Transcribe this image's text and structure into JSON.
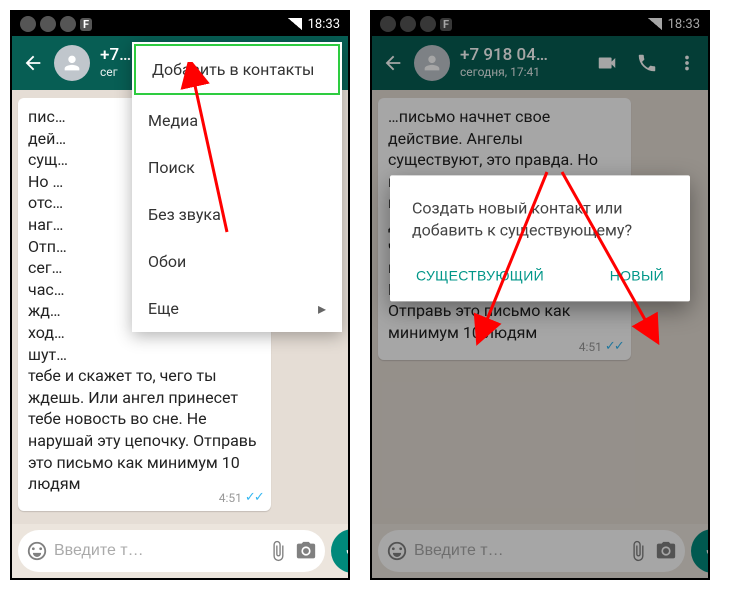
{
  "statusbar": {
    "time": "18:33",
    "f_icon": "F"
  },
  "left": {
    "header": {
      "contact_name": "+7…",
      "subline": "сег"
    },
    "menu": {
      "add_to_contacts": "Добавить в контакты",
      "media": "Медиа",
      "search": "Поиск",
      "mute": "Без звука",
      "wallpaper": "Обои",
      "more": "Еще"
    },
    "bubble": {
      "text": "пис…\nдей…\nсущ…\nНо …\nотс…\nнаг…\nОтп…\nсег…\nчас…\nжд…\nход…\nшут…\nтебе и скажет то, чего ты ждешь. Или ангел принесет тебе новость во сне. Не нарушай эту цепочку. Отправь это письмо как минимум 10 людям",
      "time": "4:51"
    },
    "input_placeholder": "Введите т…"
  },
  "right": {
    "header": {
      "contact_name": "+7 918 04…",
      "subline": "сегодня, 17:41"
    },
    "bubble": {
      "text": "…письмо начнет свое действие. Ангелы существуют, это правда. Но иногда у них отсутствуют крылья, и мы называем их друзьями. …тебе и скажет то, чего ты ждешь. Или ангел принесет тебе новость во сне. Не нарушай эту цепочку. Отправь это письмо как минимум 10 людям",
      "time": "4:51"
    },
    "dialog": {
      "message": "Создать новый контакт или добавить к существующему?",
      "existing": "СУЩЕСТВУЮЩИЙ",
      "new": "НОВЫЙ"
    },
    "input_placeholder": "Введите т…"
  }
}
